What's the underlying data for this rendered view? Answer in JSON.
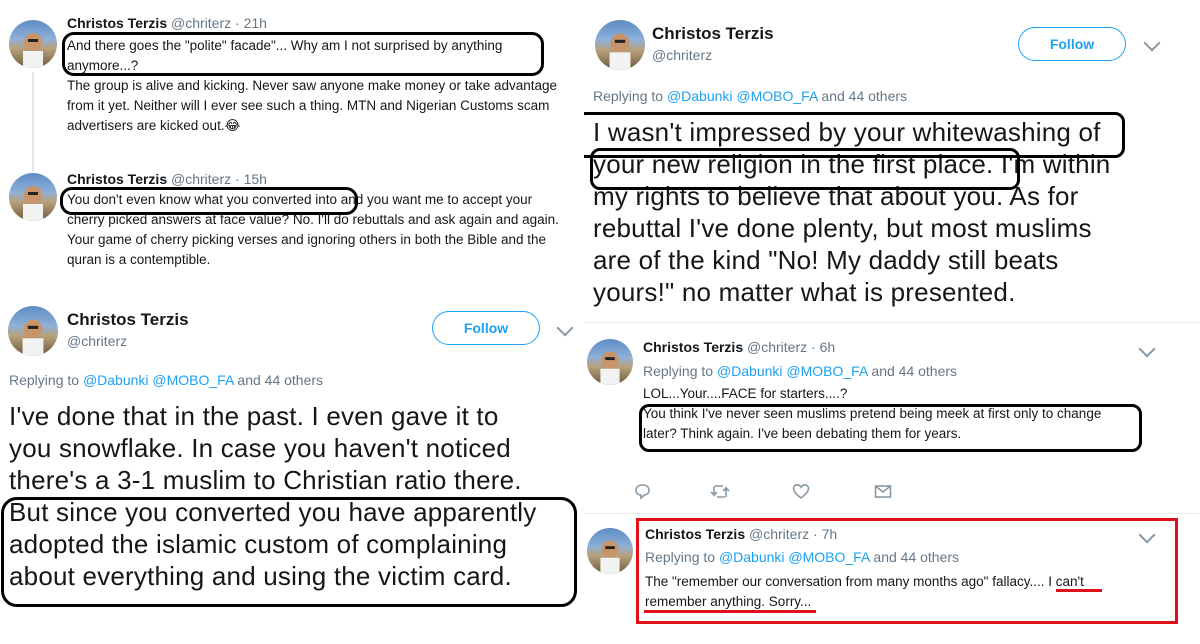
{
  "left": {
    "tweet1": {
      "name": "Christos Terzis",
      "handle": "@chriterz",
      "time": "21h",
      "line1": "And there goes the \"polite\" facade\"... Why am I not surprised by anything",
      "line2": "anymore...?",
      "line3": "The group is alive and kicking. Never saw anyone make money or take advantage",
      "line4": "from it yet. Neither will I ever see such a thing. MTN and Nigerian Customs scam",
      "line5": "advertisers are kicked out.😂"
    },
    "tweet2": {
      "name": "Christos Terzis",
      "handle": "@chriterz",
      "time": "15h",
      "line1a": "You don't even know what you converted into",
      "line1b": " and you want me to accept your",
      "line2": "cherry picked answers at face value? No. I'll do rebuttals and ask again and again.",
      "line3": "Your game of cherry picking verses and ignoring others in both the Bible and the",
      "line4": "quran is a contemptible."
    },
    "main": {
      "name": "Christos Terzis",
      "handle": "@chriterz",
      "follow_label": "Follow",
      "replying_prefix": "Replying to",
      "replying_users": "@Dabunki @MOBO_FA",
      "replying_suffix": "and 44 others",
      "lines": [
        "I've done that in the past. I even gave it to",
        "you snowflake. In case you haven't noticed",
        "there's a 3-1 muslim to Christian ratio there.",
        "But since you converted you have apparently",
        "adopted the islamic custom of complaining",
        "about everything and using the victim card."
      ]
    }
  },
  "right": {
    "main": {
      "name": "Christos Terzis",
      "handle": "@chriterz",
      "follow_label": "Follow",
      "replying_prefix": "Replying to",
      "replying_users": "@Dabunki @MOBO_FA",
      "replying_suffix": "and 44 others",
      "lines": [
        "I wasn't impressed by your whitewashing of",
        "your new religion in the first place. I'm within",
        "my rights to believe that about you. As for",
        "rebuttal I've done plenty, but most muslims",
        "are of the kind \"No! My daddy still beats",
        "yours!\" no matter what is presented."
      ]
    },
    "reply1": {
      "name": "Christos Terzis",
      "handle": "@chriterz",
      "time": "6h",
      "replying_prefix": "Replying to",
      "replying_users": "@Dabunki @MOBO_FA",
      "replying_suffix": "and 44 others",
      "line1": "LOL...Your....FACE for starters....?",
      "line2": "You think I've never seen muslims pretend being meek at first only to change",
      "line3": "later? Think again. I've been debating them for years."
    },
    "reply2": {
      "name": "Christos Terzis",
      "handle": "@chriterz",
      "time": "7h",
      "replying_prefix": "Replying to",
      "replying_users": "@Dabunki @MOBO_FA",
      "replying_suffix": "and 44 others",
      "line1a": "The \"remember our conversation from many months ago\" fallacy....",
      "line1b": " I can't",
      "line2": "remember anything. Sorry..."
    }
  },
  "icons": [
    "avatar",
    "chevron-down-icon",
    "reply-icon",
    "retweet-icon",
    "like-icon",
    "message-icon"
  ],
  "colors": {
    "link": "#1da1f2",
    "muted": "#657786",
    "highlight_box": "#e0101a"
  }
}
